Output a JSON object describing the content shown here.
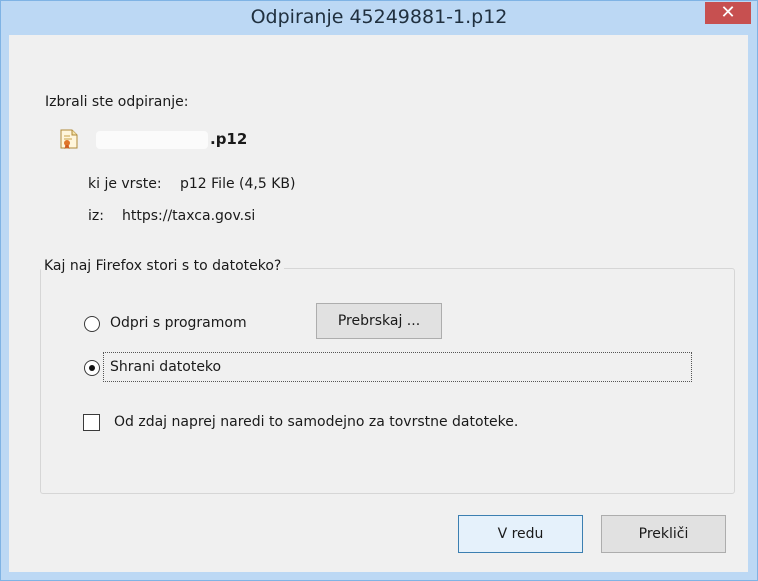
{
  "window": {
    "title": "Odpiranje 45249881-1.p12",
    "close_glyph": "✕"
  },
  "intro": "Izbrali ste odpiranje:",
  "file": {
    "icon": "certificate-file-icon",
    "name": ".p12"
  },
  "type_line": {
    "label": "ki je vrste:",
    "value": "p12 File (4,5 KB)"
  },
  "from_line": {
    "label": "iz:",
    "value": "https://taxca.gov.si"
  },
  "group": {
    "legend": "Kaj naj Firefox stori s to datoteko?",
    "open_with_label": "Odpri s programom",
    "browse_label": "Prebrskaj ...",
    "save_label": "Shrani datoteko",
    "selected": "save",
    "auto_label": "Od zdaj naprej naredi to samodejno za tovrstne datoteke."
  },
  "buttons": {
    "ok": "V redu",
    "cancel": "Prekliči"
  },
  "colors": {
    "titlebar": "#bcd8f4",
    "close": "#c75050",
    "dialog": "#f0f0f0"
  }
}
